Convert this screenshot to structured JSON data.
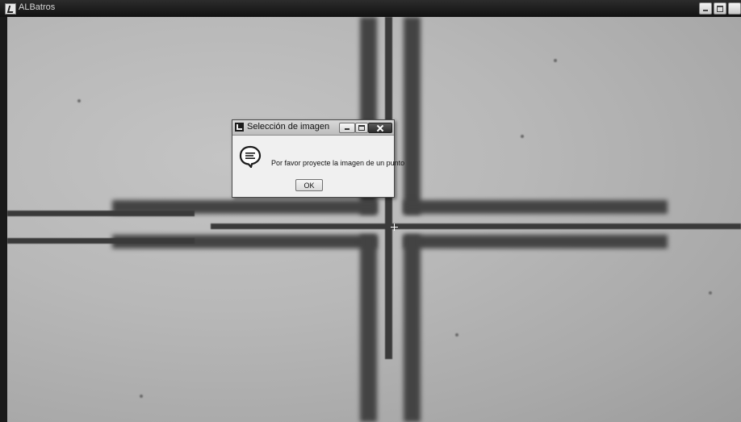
{
  "window": {
    "title": "ALBatros",
    "controls": [
      "minimize",
      "maximize",
      "close"
    ]
  },
  "dialog": {
    "title": "Selección de imagen",
    "icon": "speech-bubble-info-icon",
    "message": "Por favor proyecte la imagen de un punto",
    "ok_label": "OK"
  },
  "view": {
    "content": "camera-image",
    "cursor": "crosshair"
  }
}
